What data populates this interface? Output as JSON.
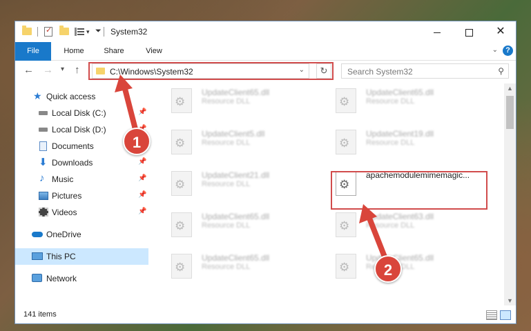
{
  "window": {
    "title": "System32"
  },
  "ribbon": {
    "tabs": [
      "File",
      "Home",
      "Share",
      "View"
    ],
    "help": "?"
  },
  "nav": {
    "address": "C:\\Windows\\System32",
    "search_placeholder": "Search System32"
  },
  "sidebar": {
    "items": [
      {
        "label": "Quick access",
        "icon": "star-icon",
        "pinned": false
      },
      {
        "label": "Local Disk (C:)",
        "icon": "drive-icon",
        "pinned": true
      },
      {
        "label": "Local Disk (D:)",
        "icon": "drive-icon",
        "pinned": true
      },
      {
        "label": "Documents",
        "icon": "documents-icon",
        "pinned": true
      },
      {
        "label": "Downloads",
        "icon": "download-icon",
        "pinned": true
      },
      {
        "label": "Music",
        "icon": "music-icon",
        "pinned": true
      },
      {
        "label": "Pictures",
        "icon": "pictures-icon",
        "pinned": true
      },
      {
        "label": "Videos",
        "icon": "videos-icon",
        "pinned": true
      },
      {
        "label": "OneDrive",
        "icon": "cloud-icon",
        "pinned": false
      },
      {
        "label": "This PC",
        "icon": "computer-icon",
        "pinned": false,
        "selected": true
      },
      {
        "label": "Network",
        "icon": "network-icon",
        "pinned": false
      }
    ]
  },
  "files": [
    {
      "name": "UpdateClient65.dll",
      "desc": "Resource DLL"
    },
    {
      "name": "UpdateClient65.dll",
      "desc": "Resource DLL"
    },
    {
      "name": "UpdateClient5.dll",
      "desc": "Resource DLL"
    },
    {
      "name": "UpdateClient19.dll",
      "desc": "Resource DLL"
    },
    {
      "name": "UpdateClient21.dll",
      "desc": "Resource DLL"
    },
    {
      "name": "apachemodulemimemagic...",
      "desc": ""
    },
    {
      "name": "UpdateClient65.dll",
      "desc": "Resource DLL"
    },
    {
      "name": "UpdateClient63.dll",
      "desc": "Resource DLL"
    },
    {
      "name": "UpdateClient65.dll",
      "desc": "Resource DLL"
    },
    {
      "name": "UpdateClient65.dll",
      "desc": "Resource DLL"
    }
  ],
  "status": {
    "count": "141 items"
  },
  "annotations": {
    "step1": "1",
    "step2": "2",
    "color": "#d9453b"
  }
}
